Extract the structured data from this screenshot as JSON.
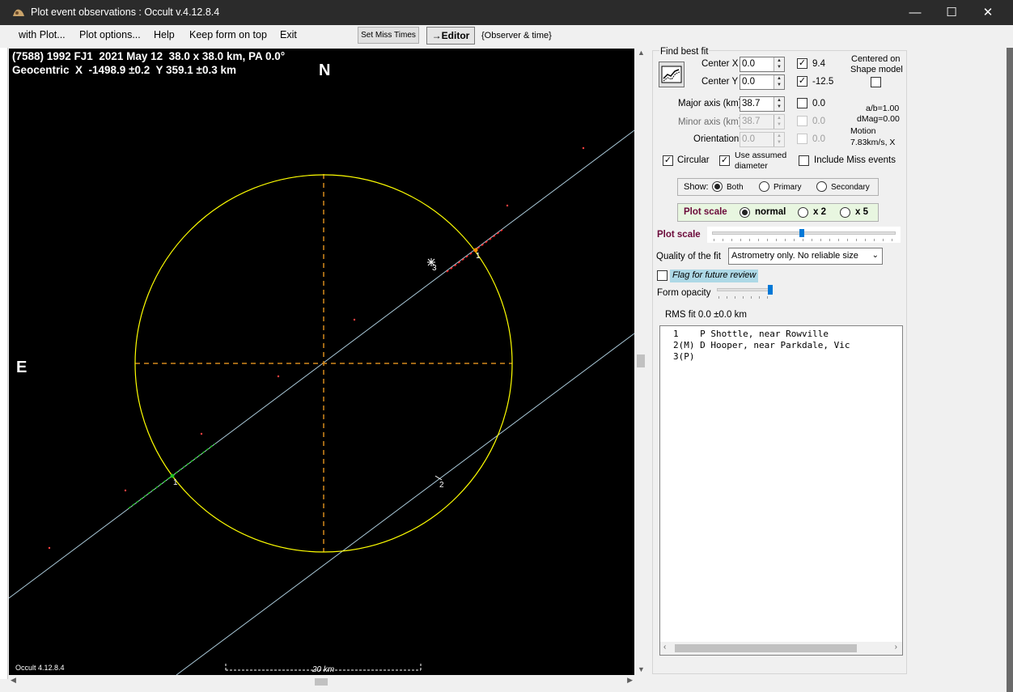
{
  "window": {
    "title": "Plot event observations : Occult v.4.12.8.4",
    "minimize_glyph": "—",
    "maximize_glyph": "☐",
    "close_glyph": "✕"
  },
  "menu": {
    "items": [
      "with Plot...",
      "Plot options...",
      "Help",
      "Keep form on top",
      "Exit"
    ],
    "set_miss_times": "Set Miss Times",
    "editor": "→Editor",
    "observer_time": "{Observer & time}"
  },
  "plot": {
    "header_line1": "(7588) 1992 FJ1  2021 May 12  38.0 x 38.0 km, PA 0.0°",
    "header_line2": "Geocentric  X  -1498.9 ±0.2  Y 359.1 ±0.3 km",
    "north": "N",
    "east": "E",
    "version": "Occult 4.12.8.4",
    "scale_label": "20 km",
    "chord_labels": [
      "1",
      "3",
      "1",
      "2"
    ]
  },
  "panel": {
    "find_best_fit": "Find best fit",
    "center_x_label": "Center X",
    "center_x_value": "0.0",
    "center_x_checked": true,
    "center_x_result": "9.4",
    "center_y_label": "Center Y",
    "center_y_value": "0.0",
    "center_y_checked": true,
    "center_y_result": "-12.5",
    "centered_on_shape_line1": "Centered on",
    "centered_on_shape_line2": "Shape model",
    "centered_on_shape_checked": false,
    "major_axis_label": "Major axis (km)",
    "major_axis_value": "38.7",
    "major_axis_result": "0.0",
    "minor_axis_label": "Minor axis (km)",
    "minor_axis_value": "38.7",
    "minor_axis_result": "0.0",
    "orientation_label": "Orientation",
    "orientation_value": "0.0",
    "orientation_result": "0.0",
    "ab_ratio": "a/b=1.00",
    "dmag": "dMag=0.00",
    "motion_label": "Motion",
    "motion_value": "7.83km/s, X",
    "circular_label": "Circular",
    "circular_checked": true,
    "use_assumed_line1": "Use assumed",
    "use_assumed_line2": "diameter",
    "use_assumed_checked": true,
    "include_miss_label": "Include Miss events",
    "include_miss_checked": false,
    "show_label": "Show:",
    "show_options": [
      "Both",
      "Primary",
      "Secondary"
    ],
    "show_selected": "Both",
    "plot_scale_label": "Plot scale",
    "plot_scale_options": [
      "normal",
      "x 2",
      "x 5"
    ],
    "plot_scale_selected": "normal",
    "plot_scale_slider_label": "Plot scale",
    "plot_scale_slider_level": 0.49,
    "quality_label": "Quality of the fit",
    "quality_value": "Astrometry only. No reliable size",
    "flag_label": "Flag for future review",
    "flag_checked": false,
    "form_opacity_label": "Form opacity",
    "form_opacity_level": 1.0,
    "rms_fit": "RMS fit  0.0 ±0.0 km",
    "observers": [
      "1    P Shottle, near Rowville",
      "2(M) D Hooper, near Parkdale, Vic",
      "3(P)"
    ]
  },
  "colors": {
    "titlebar": "#2b2b2b",
    "plot_bg": "#000000",
    "ellipse": "#ffff00",
    "axes": "#d4891c",
    "chord_line": "#a9c8d8",
    "chord_red": "#ff2020",
    "chord_green": "#20c020",
    "plot_scale_text": "#6b0a3a",
    "flag_bg": "#add8e6"
  }
}
